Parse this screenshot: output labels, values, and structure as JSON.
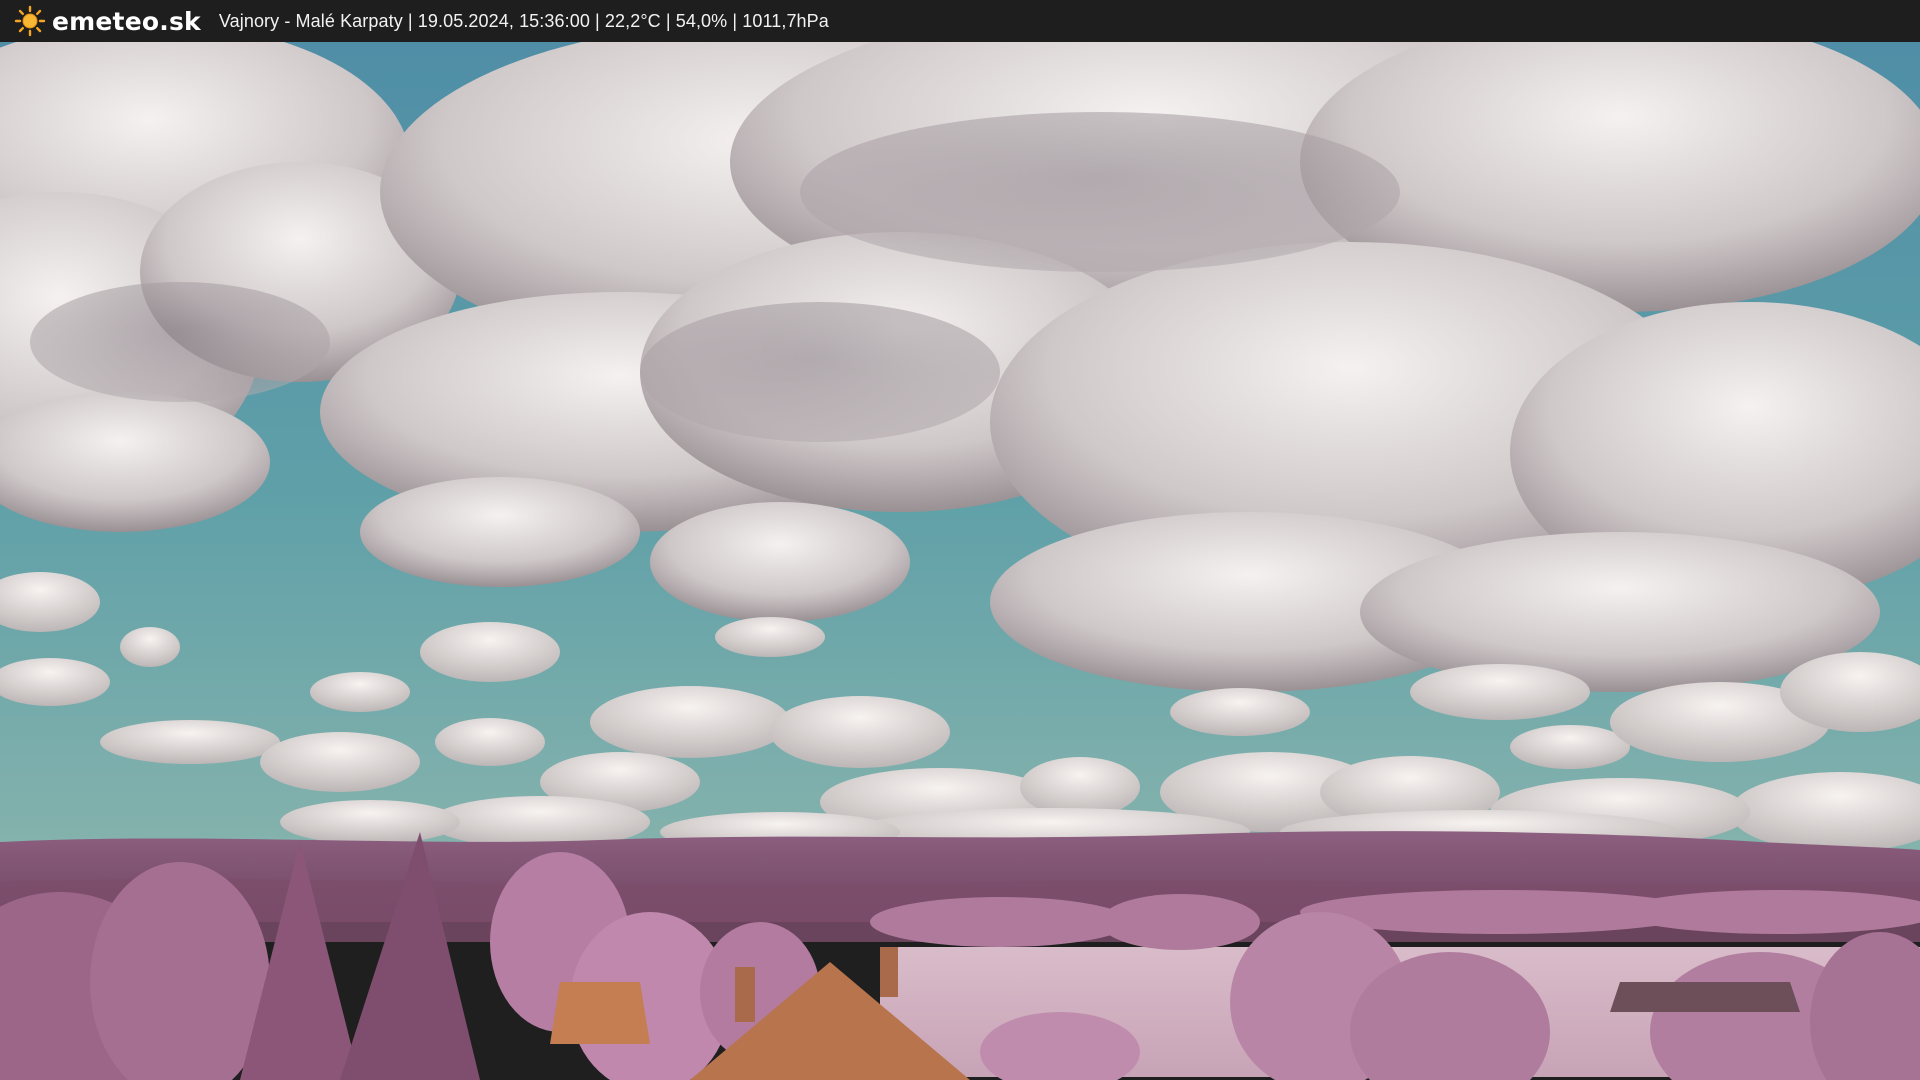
{
  "header": {
    "brand": "emeteo.sk",
    "info": "Vajnory - Malé Karpaty | 19.05.2024, 15:36:00 | 22,2°C | 54,0% | 1011,7hPa",
    "logo_icon": "sun-icon",
    "brand_color": "#ffffff",
    "bar_color": "#1e1e1e",
    "sun_color": "#f5a623"
  },
  "scene": {
    "sky_color": "#5e9ea6",
    "cloud_color": "#e8e4e4",
    "hills_color": "#8a5a78",
    "vegetation_color": "#b67aa0",
    "roof_color": "#c07a52"
  }
}
